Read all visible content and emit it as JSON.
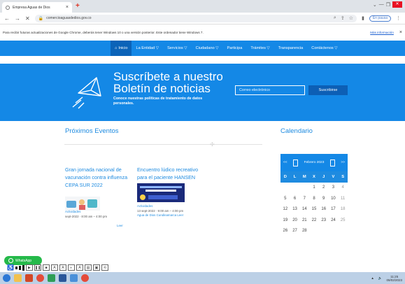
{
  "browser": {
    "tab_title": "Empresa Aguas de Dios",
    "url": "comercioaguasdedios.gov.co",
    "pause_label": "En pausa",
    "info_text": "Para recibir futuras actualizaciones de Google Chrome, deberás tener Windows 10 o una versión posterior. Este ordenador tiene Windows 7.",
    "info_more": "Más información"
  },
  "nav": {
    "items": [
      "Inicio",
      "La Entidad ▽",
      "Servicios ▽",
      "Ciudadano ▽",
      "Participa",
      "Trámites ▽",
      "Transparencia",
      "Contáctenos ▽"
    ]
  },
  "hero": {
    "title": "Suscríbete a nuestro Boletín de noticias",
    "subtitle": "Conoce nuestras políticas de tratamiento de datos personales.",
    "email_placeholder": "Correo electrónico",
    "subscribe_label": "Suscribirse"
  },
  "events": {
    "title": "Próximos Eventos",
    "items": [
      {
        "title": "Gran jornada nacional de vacunación contra influenza CEPA SUR 2022",
        "category": "Actividades",
        "date": "sept-2022 · 8:00 am – 4:00 pm",
        "more": "Leer"
      },
      {
        "title": "Encuentro lúdico recreativo para el paciente HANSEN",
        "category": "Actividades",
        "date": "13 sept-2022 · 9:00 am – 4:00 pm",
        "location": "Agua de Dios Cundinamarca",
        "more": "Leer"
      }
    ]
  },
  "calendar": {
    "title": "Calendario",
    "month_label": "Febrero 2023",
    "prev": "<<",
    "next": ">>",
    "days": [
      "D",
      "L",
      "M",
      "X",
      "J",
      "V",
      "S"
    ],
    "dates": [
      "",
      "",
      "",
      "1",
      "2",
      "3",
      "4",
      "5",
      "6",
      "7",
      "8",
      "9",
      "10",
      "11",
      "12",
      "13",
      "14",
      "15",
      "16",
      "17",
      "18",
      "19",
      "20",
      "21",
      "22",
      "23",
      "24",
      "25",
      "26",
      "27",
      "28",
      "",
      "",
      "",
      ""
    ]
  },
  "whatsapp": {
    "label": "WhatsApp"
  },
  "taskbar": {
    "time": "11:25",
    "date": "09/02/2023"
  },
  "colors": {
    "primary": "#1488e6",
    "nav_active": "#0b63b8",
    "whatsapp": "#25b94a"
  }
}
